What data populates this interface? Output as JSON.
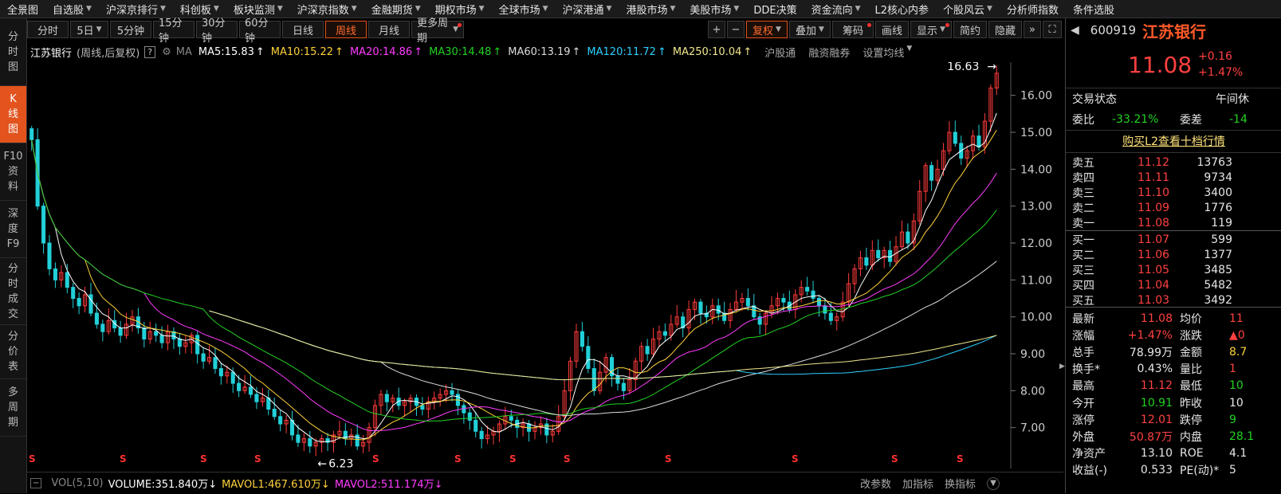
{
  "topnav": [
    {
      "label": "全景图",
      "caret": false
    },
    {
      "label": "自选股",
      "caret": true
    },
    {
      "label": "沪深京排行",
      "caret": true
    },
    {
      "label": "科创板",
      "caret": true
    },
    {
      "label": "板块监测",
      "caret": true
    },
    {
      "label": "沪深京指数",
      "caret": true
    },
    {
      "label": "金融期货",
      "caret": true
    },
    {
      "label": "期权市场",
      "caret": true
    },
    {
      "label": "全球市场",
      "caret": true
    },
    {
      "label": "沪深港通",
      "caret": true
    },
    {
      "label": "港股市场",
      "caret": true
    },
    {
      "label": "美股市场",
      "caret": true
    },
    {
      "label": "DDE决策",
      "caret": false
    },
    {
      "label": "资金流向",
      "caret": true
    },
    {
      "label": "L2核心内参",
      "caret": false
    },
    {
      "label": "个股风云",
      "caret": true
    },
    {
      "label": "分析师指数",
      "caret": false
    },
    {
      "label": "条件选股",
      "caret": false
    }
  ],
  "leftbar": [
    {
      "label": [
        "分",
        "时",
        "图"
      ],
      "active": false
    },
    {
      "label": [
        "K",
        "线",
        "图"
      ],
      "active": true
    },
    {
      "label": [
        "F10",
        "资",
        "料"
      ],
      "active": false
    },
    {
      "label": [
        "深",
        "度",
        "F9"
      ],
      "active": false
    },
    {
      "label": [
        "分",
        "时",
        "成",
        "交"
      ],
      "active": false
    },
    {
      "label": [
        "分",
        "价",
        "表"
      ],
      "active": false
    },
    {
      "label": [
        "多",
        "周",
        "期"
      ],
      "active": false
    }
  ],
  "toolbar": {
    "periods": [
      "分时",
      "5日",
      "5分钟",
      "15分钟",
      "30分钟",
      "60分钟",
      "日线",
      "周线",
      "月线",
      "更多周期"
    ],
    "active_period": "周线",
    "zoom_in": "+",
    "zoom_out": "−",
    "tools": [
      "复权",
      "叠加",
      "筹码",
      "画线",
      "显示",
      "简约",
      "隐藏"
    ],
    "expand_icon": "»",
    "fullscreen_icon": "⛶"
  },
  "infobar": {
    "stock_name": "江苏银行",
    "mode": "(周线,后复权)",
    "help": "?",
    "ma_label": "MA",
    "ma_items": [
      {
        "text": "MA5:15.83",
        "color": "#ffffff"
      },
      {
        "text": "MA10:15.22",
        "color": "#ffd23a"
      },
      {
        "text": "MA20:14.86",
        "color": "#ff3cff"
      },
      {
        "text": "MA30:14.48",
        "color": "#22d222"
      },
      {
        "text": "MA60:13.19",
        "color": "#dddddd"
      },
      {
        "text": "MA120:11.72",
        "color": "#2ed0ff"
      },
      {
        "text": "MA250:10.04",
        "color": "#f0e68c"
      }
    ],
    "links": [
      "沪股通",
      "融资融券",
      "设置均线"
    ]
  },
  "chart_data": {
    "type": "candlestick",
    "y_ticks": [
      "16.00",
      "15.00",
      "14.00",
      "13.00",
      "12.00",
      "11.00",
      "10.00",
      "9.00",
      "8.00",
      "7.00"
    ],
    "ylim": [
      6.0,
      16.9
    ],
    "max_label": "16.63",
    "min_label": "6.23",
    "closes": [
      14.8,
      13.0,
      12.0,
      11.3,
      11.0,
      11.2,
      10.8,
      10.5,
      10.3,
      10.6,
      10.1,
      9.8,
      9.6,
      9.9,
      9.7,
      9.5,
      9.8,
      10.0,
      9.7,
      9.4,
      9.6,
      9.5,
      9.3,
      9.6,
      9.4,
      9.2,
      9.3,
      9.5,
      9.0,
      8.8,
      8.9,
      8.6,
      8.4,
      8.5,
      8.2,
      8.0,
      8.1,
      7.9,
      7.7,
      7.8,
      7.5,
      7.3,
      7.1,
      7.2,
      6.8,
      6.6,
      6.7,
      6.5,
      6.6,
      6.7,
      6.6,
      6.8,
      6.9,
      6.7,
      6.8,
      6.5,
      6.6,
      7.0,
      7.6,
      7.9,
      7.7,
      7.8,
      7.6,
      7.7,
      7.8,
      7.6,
      7.5,
      7.7,
      7.8,
      7.9,
      8.0,
      7.9,
      7.6,
      7.4,
      7.2,
      6.9,
      6.7,
      6.8,
      6.9,
      7.1,
      7.3,
      7.2,
      7.0,
      7.1,
      6.9,
      7.0,
      7.1,
      6.8,
      6.9,
      7.3,
      8.0,
      8.8,
      9.6,
      9.2,
      8.6,
      8.0,
      8.5,
      8.9,
      8.4,
      8.2,
      8.0,
      8.3,
      8.8,
      9.2,
      9.0,
      9.4,
      9.6,
      9.5,
      9.8,
      10.0,
      9.7,
      10.2,
      10.4,
      10.1,
      10.0,
      10.3,
      10.1,
      9.9,
      10.2,
      10.4,
      10.5,
      10.3,
      10.0,
      9.8,
      10.1,
      10.3,
      10.5,
      10.4,
      10.2,
      10.6,
      10.8,
      10.7,
      10.5,
      10.3,
      10.1,
      9.9,
      10.0,
      10.4,
      10.9,
      11.3,
      11.6,
      11.4,
      11.8,
      11.6,
      11.8,
      11.5,
      11.9,
      12.3,
      12.0,
      12.6,
      13.4,
      14.1,
      13.7,
      14.0,
      14.5,
      15.0,
      14.7,
      14.3,
      14.5,
      14.9,
      14.6,
      15.3,
      16.2,
      16.6
    ]
  },
  "dividend_marker": "S",
  "volbar": {
    "left": "VOL(5,10)",
    "items": [
      {
        "text": "VOLUME:351.840万↓",
        "color": "#ffffff"
      },
      {
        "text": "MAVOL1:467.610万↓",
        "color": "#ffd23a"
      },
      {
        "text": "MAVOL2:511.174万↓",
        "color": "#ff3cff"
      }
    ],
    "tabs": [
      "改参数",
      "加指标",
      "换指标"
    ]
  },
  "right_panel": {
    "code": "600919",
    "name": "江苏银行",
    "price": "11.08",
    "change": "+0.16",
    "change_pct": "+1.47%",
    "status_label": "交易状态",
    "status_value": "午间休",
    "weibi_label": "委比",
    "weibi_value": "-33.21%",
    "weicha_label": "委差",
    "weicha_value": "-14",
    "l2_link": "购买L2查看十档行情",
    "asks": [
      {
        "label": "卖五",
        "price": "11.12",
        "vol": "13763"
      },
      {
        "label": "卖四",
        "price": "11.11",
        "vol": "9734"
      },
      {
        "label": "卖三",
        "price": "11.10",
        "vol": "3400"
      },
      {
        "label": "卖二",
        "price": "11.09",
        "vol": "1776"
      },
      {
        "label": "卖一",
        "price": "11.08",
        "vol": "119"
      }
    ],
    "bids": [
      {
        "label": "买一",
        "price": "11.07",
        "vol": "599"
      },
      {
        "label": "买二",
        "price": "11.06",
        "vol": "1377"
      },
      {
        "label": "买三",
        "price": "11.05",
        "vol": "3485"
      },
      {
        "label": "买四",
        "price": "11.04",
        "vol": "5482"
      },
      {
        "label": "买五",
        "price": "11.03",
        "vol": "3492"
      }
    ],
    "stats": [
      {
        "l1": "最新",
        "v1": "11.08",
        "c1": "red",
        "l2": "均价",
        "v2": "11",
        "c2": "red"
      },
      {
        "l1": "涨幅",
        "v1": "+1.47%",
        "c1": "red",
        "l2": "涨跌",
        "v2": "▲0",
        "c2": "red"
      },
      {
        "l1": "总手",
        "v1": "78.99万",
        "c1": "white",
        "l2": "金额",
        "v2": "8.7",
        "c2": "yellow"
      },
      {
        "l1": "换手*",
        "v1": "0.43%",
        "c1": "white",
        "l2": "量比",
        "v2": "1",
        "c2": "red"
      },
      {
        "l1": "最高",
        "v1": "11.12",
        "c1": "red",
        "l2": "最低",
        "v2": "10",
        "c2": "green"
      },
      {
        "l1": "今开",
        "v1": "10.91",
        "c1": "green",
        "l2": "昨收",
        "v2": "10",
        "c2": "white"
      },
      {
        "l1": "涨停",
        "v1": "12.01",
        "c1": "red",
        "l2": "跌停",
        "v2": "9",
        "c2": "green"
      },
      {
        "l1": "外盘",
        "v1": "50.87万",
        "c1": "red",
        "l2": "内盘",
        "v2": "28.1",
        "c2": "green"
      },
      {
        "l1": "净资产",
        "v1": "13.10",
        "c1": "white",
        "l2": "ROE",
        "v2": "4.1",
        "c2": "white"
      },
      {
        "l1": "收益(-)",
        "v1": "0.533",
        "c1": "white",
        "l2": "PE(动)*",
        "v2": "5",
        "c2": "white"
      }
    ]
  }
}
